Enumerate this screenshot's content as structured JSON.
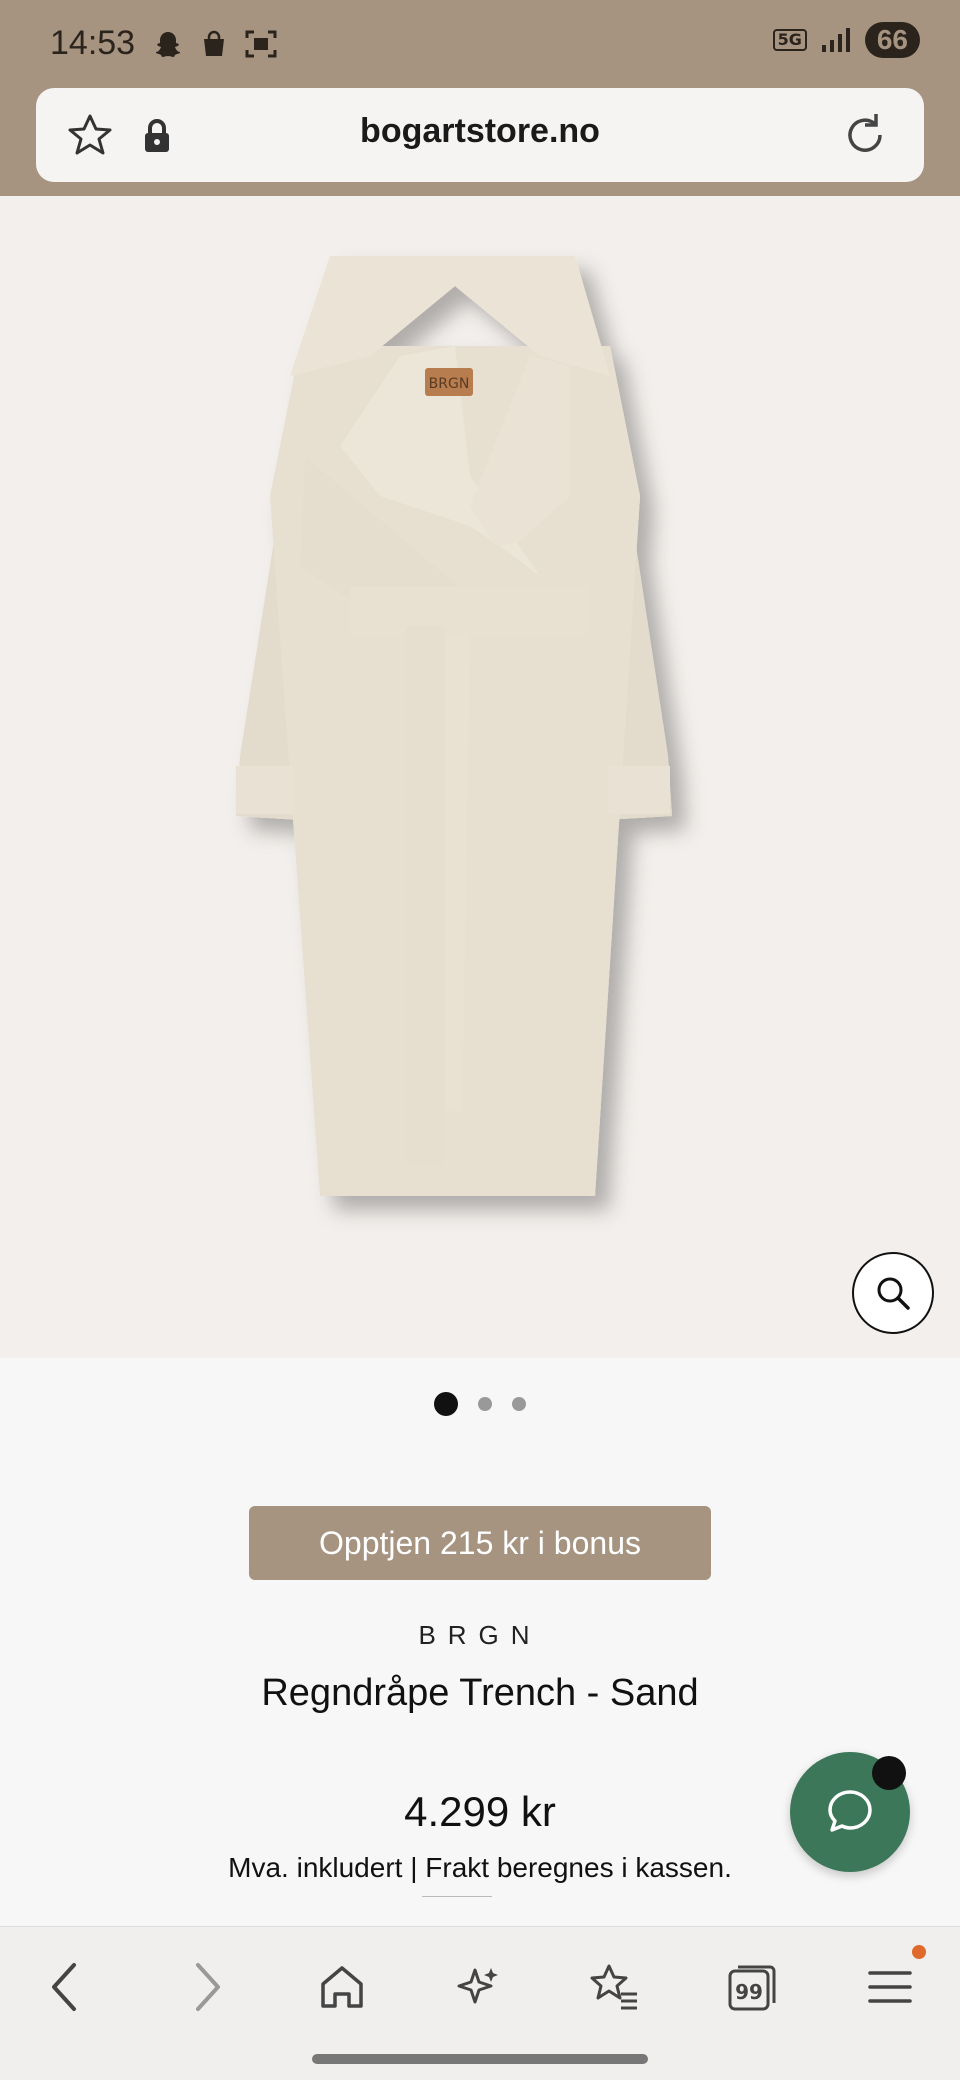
{
  "status_bar": {
    "time": "14:53",
    "network": "5G",
    "battery": "66",
    "icons": [
      "snapchat-icon",
      "shopping-bag-icon",
      "screenshot-icon",
      "signal-icon"
    ]
  },
  "address_bar": {
    "url": "bogartstore.no",
    "icons": [
      "star-icon",
      "lock-icon",
      "reload-icon"
    ]
  },
  "product": {
    "image_alt": "Regndråpe Trench - Sand",
    "image_label": "BRGN",
    "gallery": {
      "count": 3,
      "active": 1
    },
    "bonus_label": "Opptjen 215 kr i bonus",
    "brand": "BRGN",
    "title": "Regndråpe Trench - Sand",
    "price": "4.299 kr",
    "tax_note": "Mva. inkludert | Frakt beregnes i kassen."
  },
  "chat": {
    "icon": "chat-bubble-icon"
  },
  "bottom_nav": {
    "items": [
      "back-icon",
      "forward-icon",
      "home-icon",
      "sparkle-icon",
      "favorites-icon",
      "tabs-icon",
      "menu-icon"
    ],
    "tabs_count": "99"
  },
  "colors": {
    "brand_tan": "#a69481",
    "chat_green": "#3b7758",
    "badge_orange": "#e06a2b"
  }
}
